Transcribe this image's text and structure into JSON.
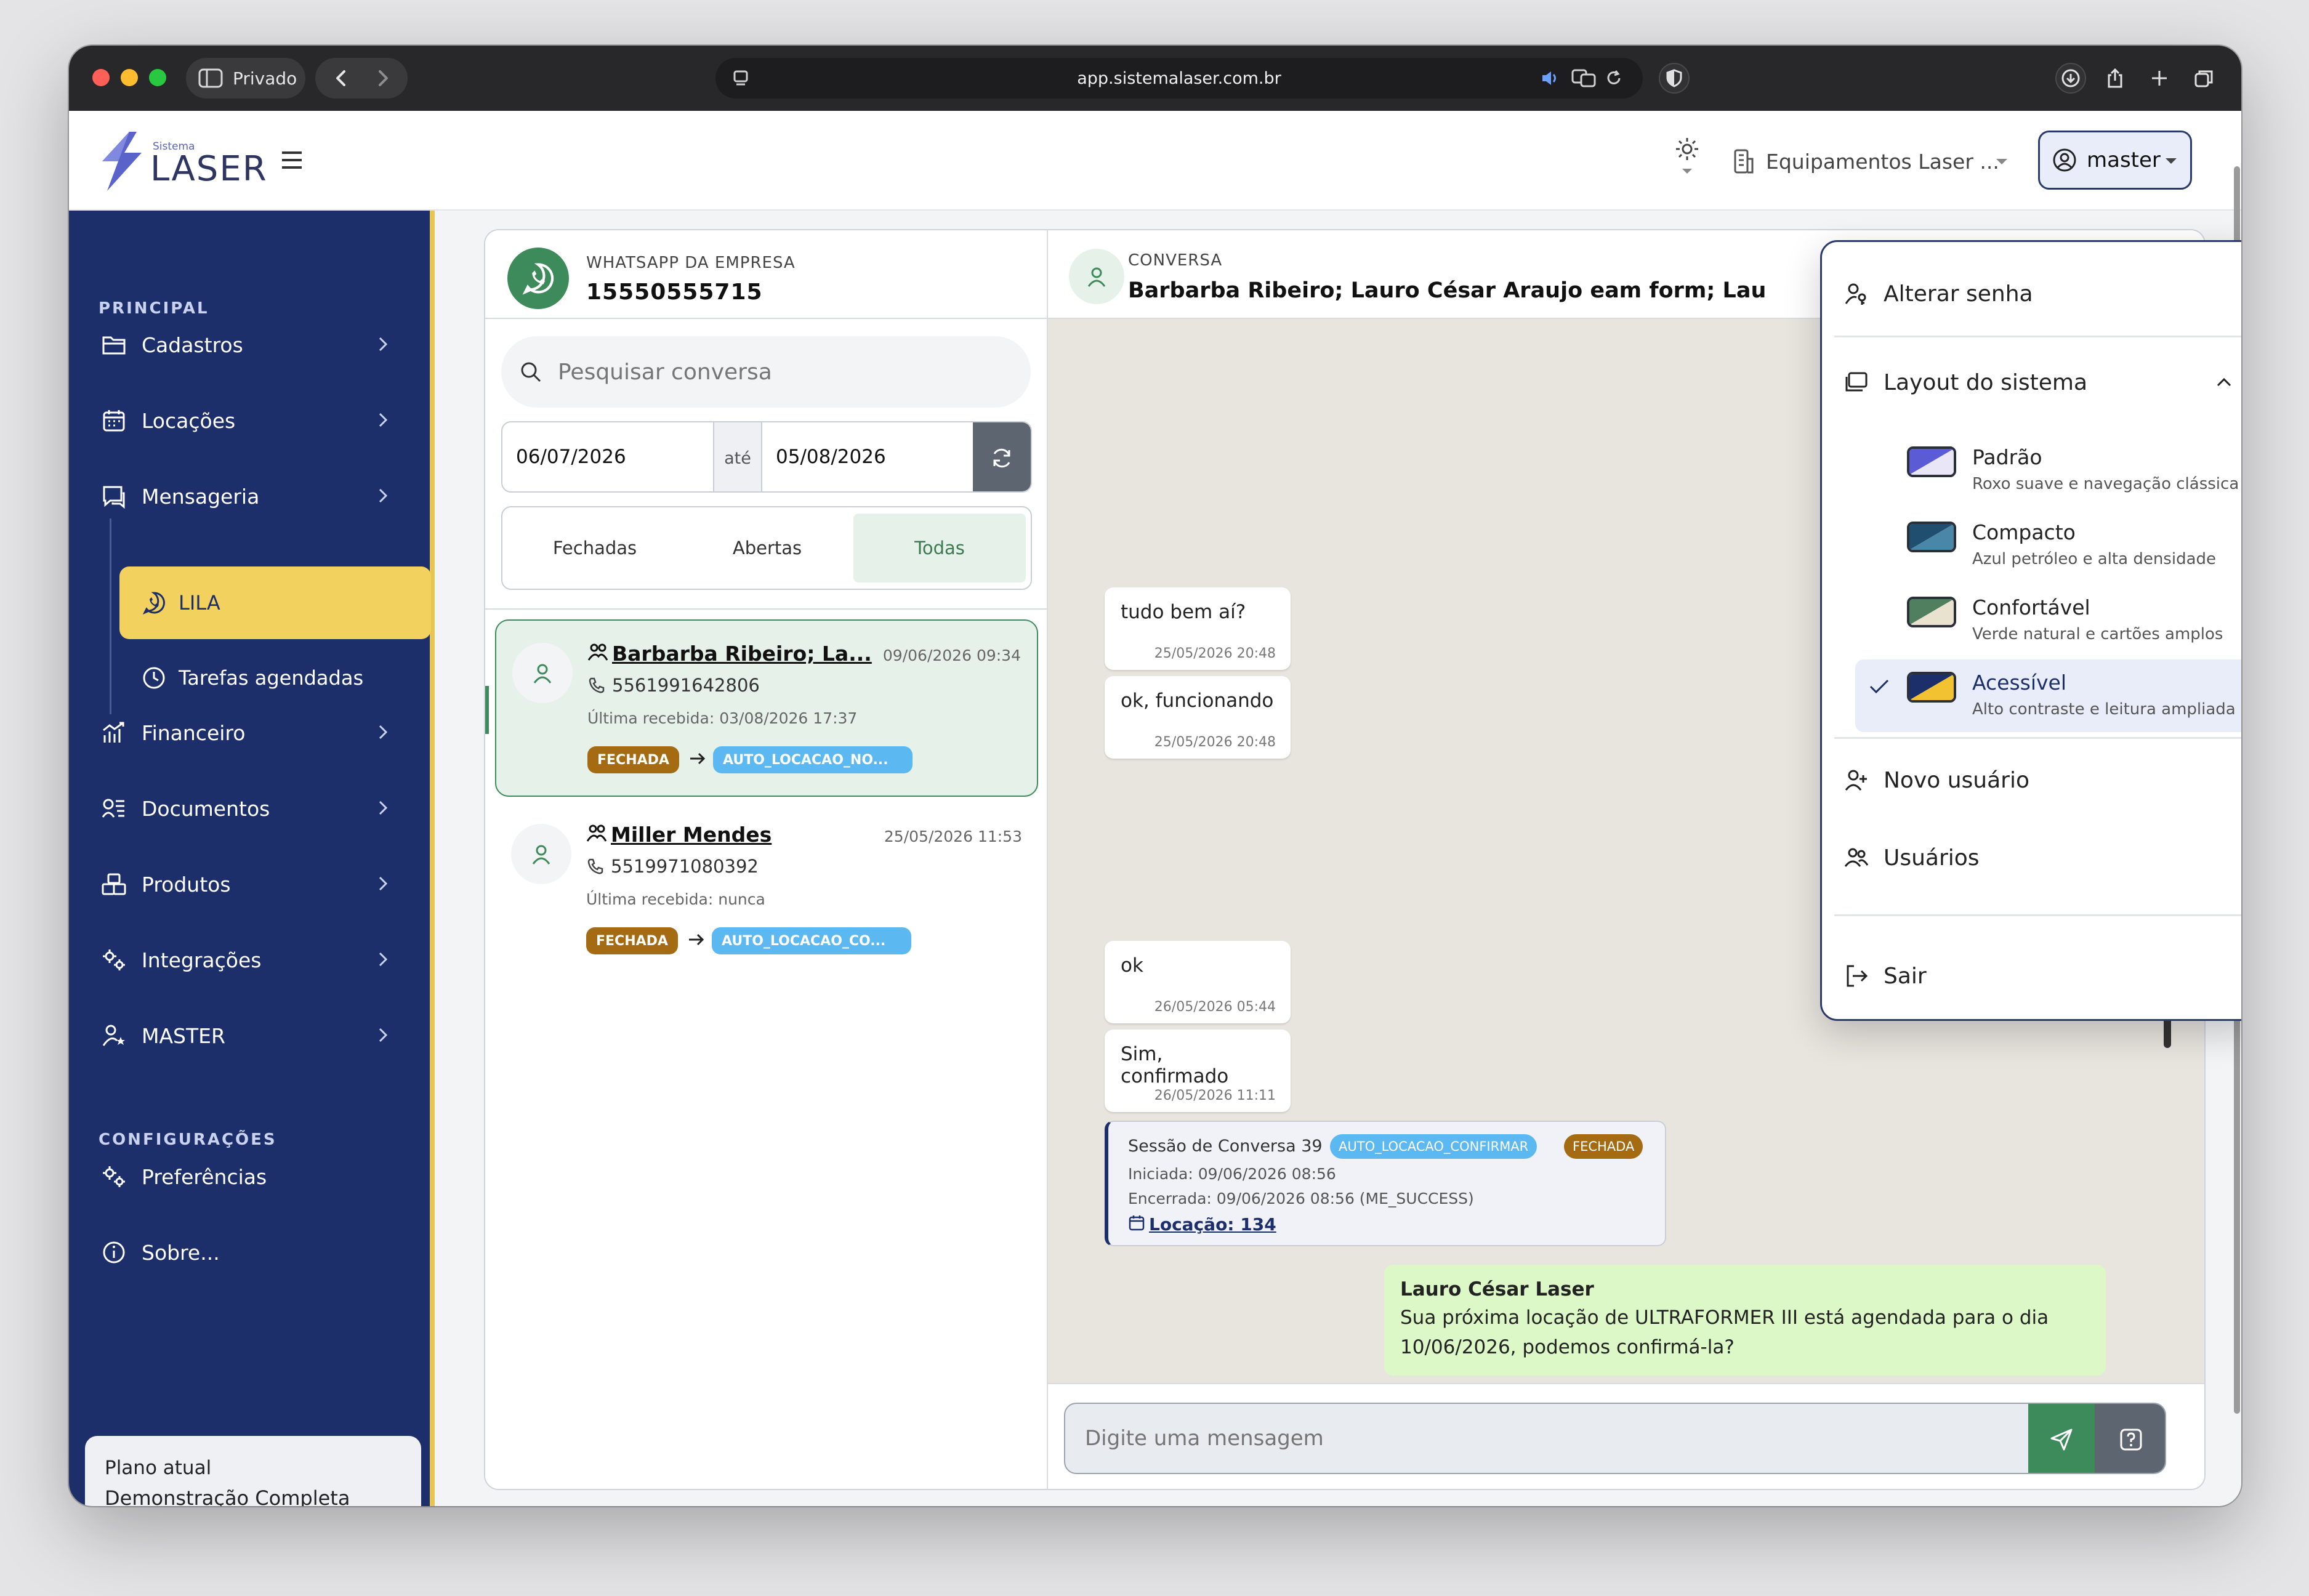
{
  "browser": {
    "tab_label": "Privado",
    "url": "app.sistemalaser.com.br"
  },
  "header": {
    "logo_small": "Sistema",
    "logo_big": "LASER",
    "company_select": "Equipamentos Laser ...",
    "user_button": "master"
  },
  "sidebar": {
    "section_principal": "PRINCIPAL",
    "section_config": "CONFIGURAÇÕES",
    "items": {
      "cadastros": "Cadastros",
      "locacoes": "Locações",
      "mensageria": "Mensageria",
      "lila": "LILA",
      "tarefas": "Tarefas agendadas",
      "financeiro": "Financeiro",
      "documentos": "Documentos",
      "produtos": "Produtos",
      "integracoes": "Integrações",
      "master": "MASTER",
      "preferencias": "Preferências",
      "sobre": "Sobre..."
    },
    "plan_label": "Plano atual",
    "plan_value": "Demonstração Completa"
  },
  "whatsapp": {
    "label": "WHATSAPP DA EMPRESA",
    "number": "15550555715",
    "search_placeholder": "Pesquisar conversa",
    "date_from": "06/07/2026",
    "date_sep": "até",
    "date_to": "05/08/2026",
    "filters": [
      "Fechadas",
      "Abertas",
      "Todas"
    ],
    "active_filter": "Todas"
  },
  "conversations": [
    {
      "name": "Barbarba Ribeiro; La...",
      "date": "09/06/2026 09:34",
      "phone": "5561991642806",
      "last": "Última recebida: 03/08/2026 17:37",
      "status": "FECHADA",
      "flow": "AUTO_LOCACAO_NO..."
    },
    {
      "name": "Miller Mendes",
      "date": "25/05/2026 11:53",
      "phone": "5519971080392",
      "last": "Última recebida: nunca",
      "status": "FECHADA",
      "flow": "AUTO_LOCACAO_CO..."
    }
  ],
  "chat": {
    "label": "CONVERSA",
    "title": "Barbarba Ribeiro; Lauro César Araujo eam form; Lau",
    "messages": [
      {
        "text": "tudo bem aí?",
        "time": "25/05/2026 20:48"
      },
      {
        "text": "ok, funcionando",
        "time": "25/05/2026 20:48"
      },
      {
        "text": "ok",
        "time": "26/05/2026 05:44"
      },
      {
        "text": "Sim, confirmado",
        "time": "26/05/2026 11:11"
      }
    ],
    "session": {
      "title": "Sessão de Conversa 39",
      "flow": "AUTO_LOCACAO_CONFIRMAR",
      "status": "FECHADA",
      "started": "Iniciada: 09/06/2026 08:56",
      "ended": "Encerrada: 09/06/2026 08:56 (ME_SUCCESS)",
      "link": "Locação: 134"
    },
    "outgoing": {
      "sender": "Lauro César Laser",
      "text": "Sua próxima locação de ULTRAFORMER III está agendada para o dia 10/06/2026, podemos confirmá-la?"
    },
    "input_placeholder": "Digite uma mensagem"
  },
  "dropdown": {
    "change_password": "Alterar senha",
    "layout": "Layout do sistema",
    "layouts": [
      {
        "name": "Padrão",
        "desc": "Roxo suave e navegação clássica",
        "c1": "#5b5bd6",
        "c2": "#e8e6f7"
      },
      {
        "name": "Compacto",
        "desc": "Azul petróleo e alta densidade",
        "c1": "#1f4e6e",
        "c2": "#4a86a8"
      },
      {
        "name": "Confortável",
        "desc": "Verde natural e cartões amplos",
        "c1": "#4f7f5f",
        "c2": "#e9e2cf"
      },
      {
        "name": "Acessível",
        "desc": "Alto contraste e leitura ampliada",
        "c1": "#1c2f6b",
        "c2": "#f2c230"
      }
    ],
    "selected_layout": "Acessível",
    "new_user": "Novo usuário",
    "users": "Usuários",
    "logout": "Sair"
  },
  "colors": {
    "sidebar": "#1c2f6b",
    "accent_yellow": "#f3d15f",
    "whatsapp_green": "#3d8a5a",
    "status_brown": "#a56b12",
    "flow_blue": "#5cb8f0"
  }
}
